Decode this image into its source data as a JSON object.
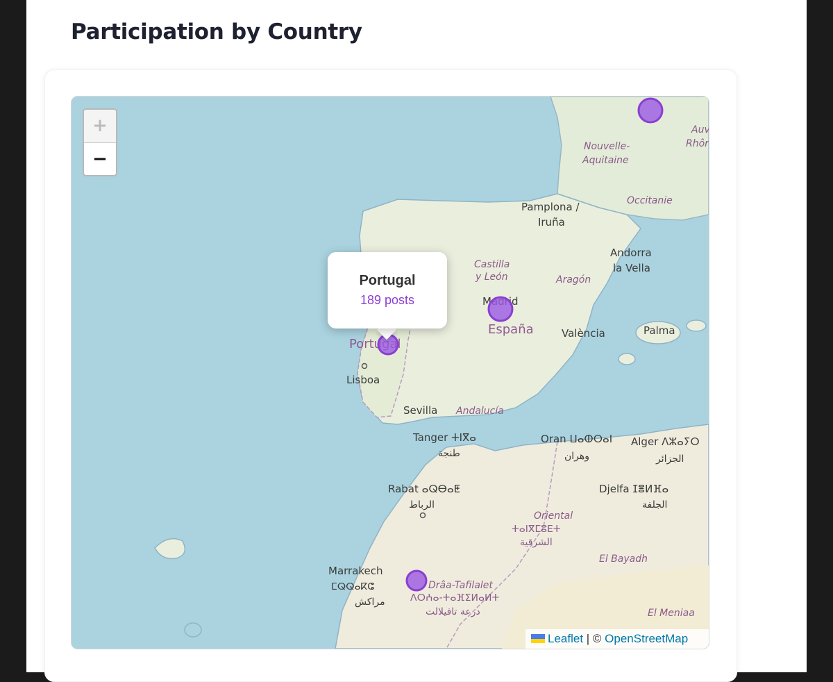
{
  "page": {
    "title": "Participation by Country"
  },
  "map": {
    "zoom_in_label": "+",
    "zoom_out_label": "−",
    "popup": {
      "country": "Portugal",
      "value": "189 posts"
    },
    "attribution": {
      "leaflet": "Leaflet",
      "separator": " | © ",
      "osm": "OpenStreetMap"
    },
    "markers": [
      {
        "name": "France",
        "color": "#9b59e3"
      },
      {
        "name": "Spain",
        "color": "#9b59e3"
      },
      {
        "name": "Portugal",
        "color": "#9b59e3"
      },
      {
        "name": "Morocco",
        "color": "#9b59e3"
      }
    ],
    "labels": {
      "nouvelle_aquitaine": [
        "Nouvelle-",
        "Aquitaine"
      ],
      "auv": [
        "Auv",
        "Rhôr"
      ],
      "occitanie": "Occitanie",
      "pamplona": [
        "Pamplona /",
        "Iruña"
      ],
      "andorra": [
        "Andorra",
        "la Vella"
      ],
      "castilla": [
        "Castilla",
        "y León"
      ],
      "aragon": "Aragón",
      "madrid": "Madrid",
      "espana": "España",
      "valencia": "València",
      "palma": "Palma",
      "portugal": "Portugal",
      "lisboa": "Lisboa",
      "sevilla": "Sevilla",
      "andalucia": "Andalucía",
      "tanger": [
        "Tanger ⵜⵏⴳⴰ",
        "طنجة"
      ],
      "oran": [
        "Oran ⵡⴰⵀⵔⴰⵏ",
        "وهران"
      ],
      "alger": [
        "Alger ⴷⵣⴰⵢⵔ",
        "الجزائر"
      ],
      "rabat": [
        "Rabat ⴰⵕⴱⴰⵟ",
        "الرباط"
      ],
      "djelfa": [
        "Djelfa ⵊⴻⵍⴼⴰ",
        "الجلفة"
      ],
      "oriental": [
        "Oriental",
        "ⵜⴰⵏⴳⵎⵓⴹⵜ",
        "الشرقية"
      ],
      "el_bayadh": "El Bayadh",
      "marrakech": [
        "Marrakech",
        "ⵎⵕⵕⴰⴽⵛ",
        "مراكش"
      ],
      "draa": [
        "Drâa-Tafilalet",
        "ⴷⵔⵄⴰ-ⵜⴰⴼⵉⵍⴰⵍⵜ",
        "درعة تافيلالت"
      ],
      "el_meniaa": "El Meniaa"
    }
  }
}
